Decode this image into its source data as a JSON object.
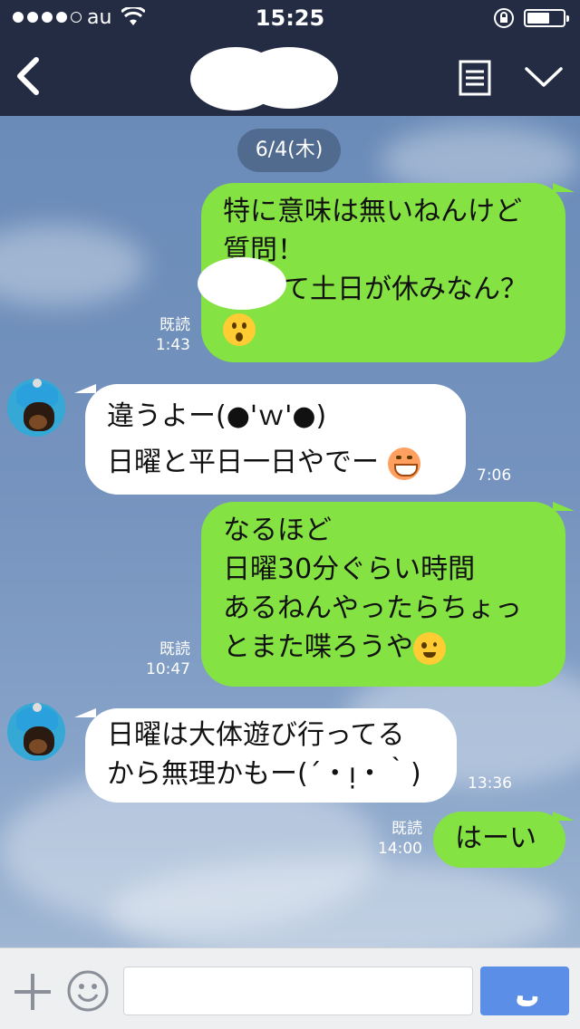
{
  "status_bar": {
    "carrier": "au",
    "time": "15:25",
    "signal_dots_filled": 4,
    "battery_level": 0.5
  },
  "nav": {
    "contact_name": "",
    "back_icon": "chevron-left-icon",
    "menu_icon": "notes-list-icon",
    "expand_icon": "chevron-down-icon"
  },
  "chat": {
    "date": "6/4(木)",
    "messages": [
      {
        "side": "out",
        "lines": [
          "特に意味は無いねんけど",
          "質問！",
          "て土日が休みなん？"
        ],
        "emoji": "surprised-face-emoji",
        "read": "既読",
        "time": "1:43"
      },
      {
        "side": "in",
        "lines": [
          "違うよー(●'ｗ'●)",
          "日曜と平日一日やでー"
        ],
        "emoji": "grinning-face-emoji",
        "time": "7:06"
      },
      {
        "side": "out",
        "lines": [
          "なるほど",
          "日曜30分ぐらい時間",
          "あるねんやったらちょっ",
          "とまた喋ろうや"
        ],
        "emoji": "winking-face-emoji",
        "read": "既読",
        "time": "10:47"
      },
      {
        "side": "in",
        "lines": [
          "日曜は大体遊び行ってる",
          "から無理かもー(´・ᴉ・｀)"
        ],
        "time": "13:36"
      },
      {
        "side": "out",
        "lines": [
          "はーい"
        ],
        "read": "既読",
        "time": "14:00"
      }
    ]
  },
  "input_bar": {
    "plus_icon": "plus-icon",
    "sticker_icon": "smiley-icon",
    "message_placeholder": "",
    "call_icon": "phone-icon"
  },
  "colors": {
    "header_bg": "#232c43",
    "outgoing_bubble": "#84e243",
    "incoming_bubble": "#ffffff",
    "call_button": "#5b8ee6"
  }
}
